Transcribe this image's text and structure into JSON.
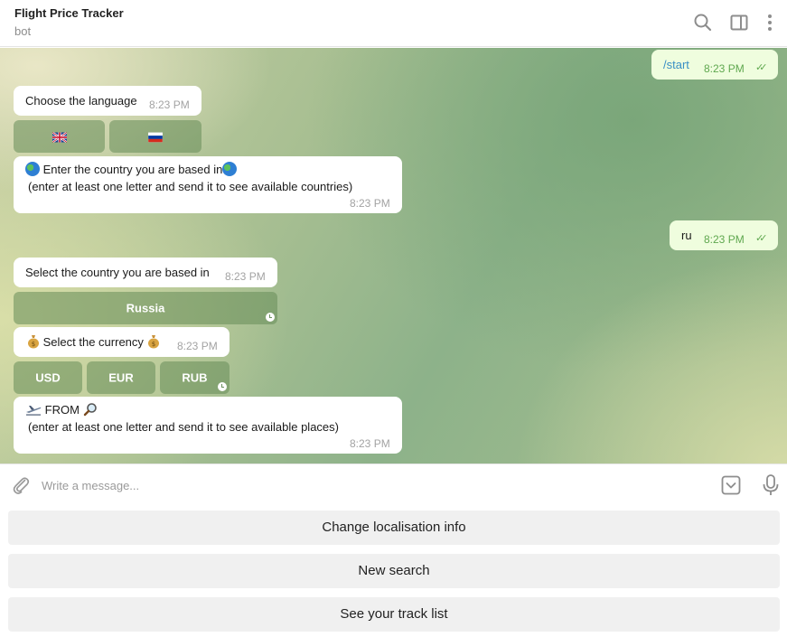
{
  "header": {
    "title": "Flight Price Tracker",
    "subtitle": "bot",
    "icons": [
      "search-icon",
      "sidebar-toggle-icon",
      "more-vert-icon"
    ]
  },
  "messages": {
    "start_cmd": {
      "text": "/start",
      "time": "8:23 PM"
    },
    "choose_language": {
      "text": "Choose the language",
      "time": "8:23 PM"
    },
    "language_buttons": [
      "uk-flag",
      "ru-flag"
    ],
    "enter_country": {
      "line1": "Enter the country you are based in",
      "line2": "(enter at least one letter and send it to see available countries)",
      "time": "8:23 PM"
    },
    "ru_reply": {
      "text": "ru",
      "time": "8:23 PM"
    },
    "select_country": {
      "text": "Select the country you are based in",
      "time": "8:23 PM"
    },
    "country_button": "Russia",
    "select_currency": {
      "text": "Select the currency",
      "time": "8:23 PM"
    },
    "currency_buttons": [
      "USD",
      "EUR",
      "RUB"
    ],
    "from": {
      "line1": "FROM",
      "line2": "(enter at least one letter and send it to see available places)",
      "time": "8:23 PM"
    }
  },
  "composer": {
    "placeholder": "Write a message..."
  },
  "reply_keyboard": [
    "Change localisation info",
    "New search",
    "See your track list"
  ],
  "colors": {
    "outgoing_bubble": "#effdde",
    "incoming_bubble": "#ffffff",
    "inline_button": "#7f9f6e",
    "reply_button": "#f0f0f0"
  }
}
